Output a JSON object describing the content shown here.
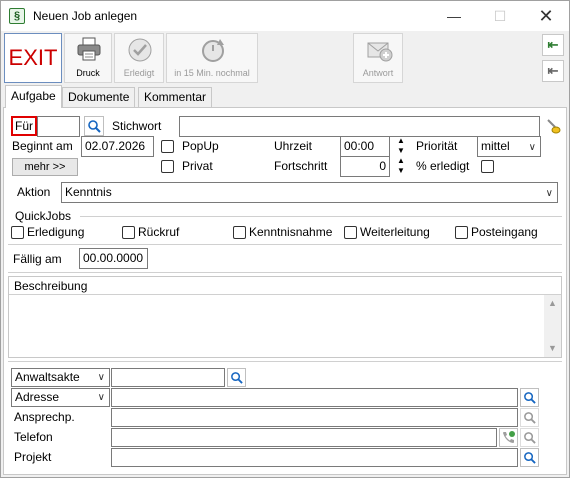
{
  "window": {
    "title": "Neuen Job anlegen",
    "app_icon": "§"
  },
  "toolbar": {
    "exit_label": "EXIT",
    "druck_label": "Druck",
    "erledigt_label": "Erledigt",
    "nochmal_label": "in 15 Min. nochmal",
    "antwort_label": "Antwort"
  },
  "tabs": [
    "Aufgabe",
    "Dokumente",
    "Kommentar"
  ],
  "form": {
    "fuer_label": "Für",
    "fuer_value": "",
    "stichwort_label": "Stichwort",
    "stichwort_value": "",
    "beginnt_label": "Beginnt am",
    "beginnt_value": "02.07.2026",
    "mehr_label": "mehr >>",
    "popup_label": "PopUp",
    "privat_label": "Privat",
    "uhrzeit_label": "Uhrzeit",
    "uhrzeit_value": "00:00",
    "fortschritt_label": "Fortschritt",
    "fortschritt_value": "0",
    "prioritaet_label": "Priorität",
    "prioritaet_value": "mittel",
    "erledigt_label": "% erledigt",
    "aktion_label": "Aktion",
    "aktion_value": "Kenntnis"
  },
  "quickjobs": {
    "title": "QuickJobs",
    "items": [
      "Erledigung",
      "Rückruf",
      "Kenntnisnahme",
      "Weiterleitung",
      "Posteingang"
    ],
    "faellig_label": "Fällig am",
    "faellig_value": "00.00.0000"
  },
  "beschreibung": {
    "title": "Beschreibung",
    "value": ""
  },
  "bottom": {
    "anwaltsakte_label": "Anwaltsakte",
    "adresse_label": "Adresse",
    "ansprechp_label": "Ansprechp.",
    "telefon_label": "Telefon",
    "projekt_label": "Projekt"
  },
  "colors": {
    "accent_red": "#e00000",
    "exit_red": "#cc0000",
    "link_blue": "#1565c0",
    "nav_green": "#2e7d32"
  }
}
